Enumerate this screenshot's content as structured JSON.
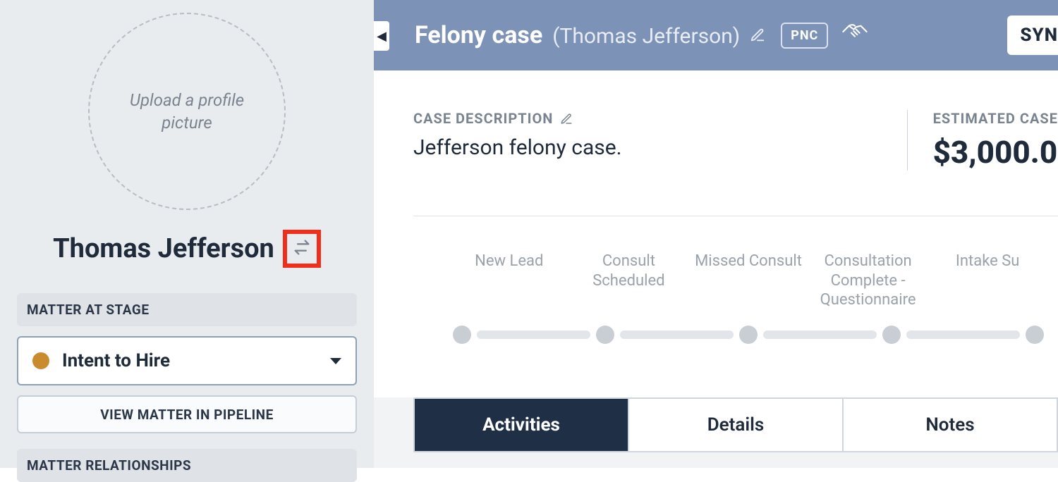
{
  "sidebar": {
    "profile_placeholder": "Upload a profile picture",
    "contact_name": "Thomas Jefferson",
    "section_stage_label": "MATTER AT STAGE",
    "stage_value": "Intent to Hire",
    "view_pipeline_label": "VIEW MATTER IN PIPELINE",
    "section_relationships_label": "MATTER RELATIONSHIPS"
  },
  "header": {
    "case_title": "Felony case",
    "contact_paren": "(Thomas Jefferson)",
    "badge": "PNC",
    "sync_label": "SYN"
  },
  "case": {
    "desc_label": "CASE DESCRIPTION",
    "desc_text": "Jefferson felony case.",
    "est_label": "ESTIMATED CASE",
    "est_value": "$3,000.0"
  },
  "pipeline": {
    "stages": [
      "New Lead",
      "Consult\nScheduled",
      "Missed Consult",
      "Consultation\nComplete -\nQuestionnaire",
      "Intake Su"
    ]
  },
  "tabs": {
    "items": [
      "Activities",
      "Details",
      "Notes"
    ],
    "active_index": 0
  }
}
